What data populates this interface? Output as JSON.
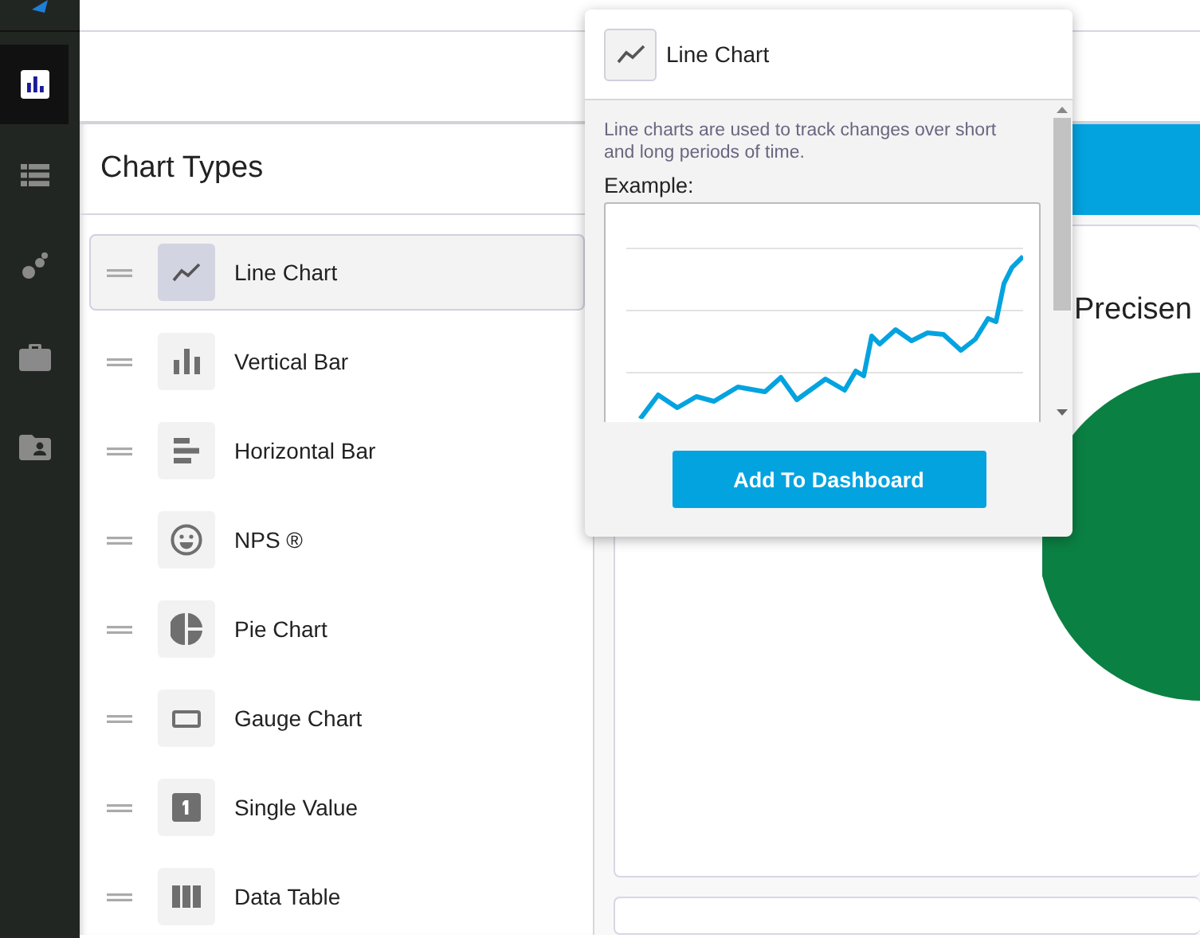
{
  "sidebar": {
    "items": [
      {
        "kind": "bar-chart",
        "selected": true
      },
      {
        "kind": "list",
        "selected": false
      },
      {
        "kind": "scatter",
        "selected": false
      },
      {
        "kind": "briefcase",
        "selected": false
      },
      {
        "kind": "folder-person",
        "selected": false
      }
    ]
  },
  "chart_types": {
    "title": "Chart Types",
    "items": [
      {
        "label": "Line Chart",
        "kind": "line",
        "selected": true
      },
      {
        "label": "Vertical Bar",
        "kind": "vbar",
        "selected": false
      },
      {
        "label": "Horizontal Bar",
        "kind": "hbar",
        "selected": false
      },
      {
        "label": "NPS ®",
        "kind": "smiley",
        "selected": false
      },
      {
        "label": "Pie Chart",
        "kind": "pie",
        "selected": false
      },
      {
        "label": "Gauge Chart",
        "kind": "gauge",
        "selected": false
      },
      {
        "label": "Single Value",
        "kind": "single",
        "selected": false
      },
      {
        "label": "Data Table",
        "kind": "table",
        "selected": false
      }
    ]
  },
  "popover": {
    "title": "Line Chart",
    "description": "Line charts are used to track changes over short and long periods of time.",
    "example_label": "Example:",
    "button": "Add To Dashboard"
  },
  "dashboard": {
    "card_title": "Precisen"
  }
}
